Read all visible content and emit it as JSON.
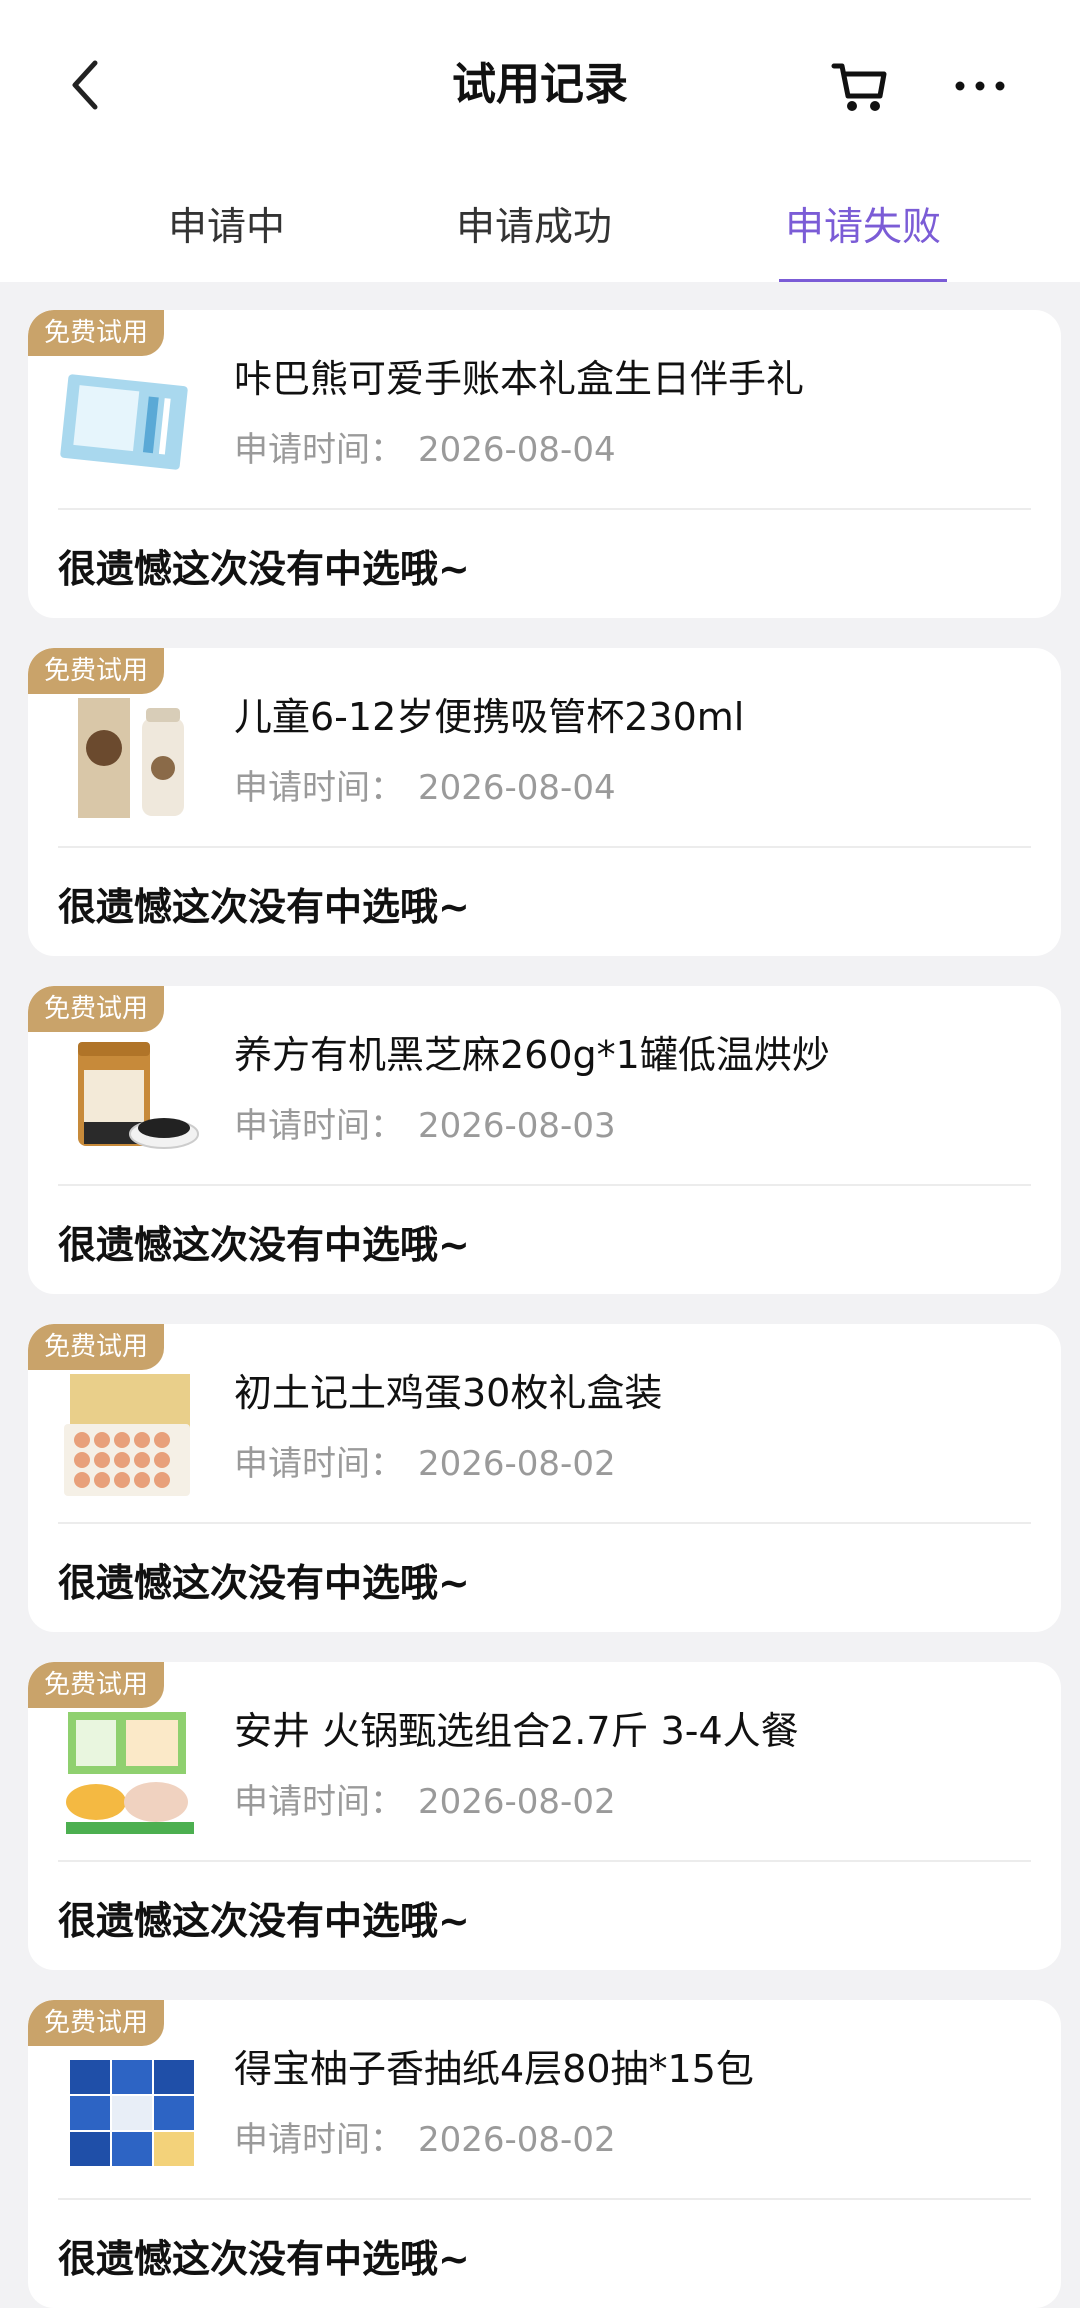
{
  "header": {
    "title": "试用记录",
    "back_icon": "chevron-left-icon",
    "cart_icon": "cart-icon",
    "more_icon": "more-dots-icon"
  },
  "tabs": [
    {
      "label": "申请中",
      "active": false
    },
    {
      "label": "申请成功",
      "active": false
    },
    {
      "label": "申请失败",
      "active": true
    }
  ],
  "colors": {
    "accent": "#7b5cd6",
    "badge": "#c9a36a",
    "background": "#f2f2f4"
  },
  "records": [
    {
      "badge": "免费试用",
      "title": "咔巴熊可爱手账本礼盒生日伴手礼",
      "apply_label": "申请时间：",
      "date": "2026-08-04",
      "result": "很遗憾这次没有中选哦~"
    },
    {
      "badge": "免费试用",
      "title": "儿童6-12岁便携吸管杯230ml",
      "apply_label": "申请时间：",
      "date": "2026-08-04",
      "result": "很遗憾这次没有中选哦~"
    },
    {
      "badge": "免费试用",
      "title": "养方有机黑芝麻260g*1罐低温烘炒",
      "apply_label": "申请时间：",
      "date": "2026-08-03",
      "result": "很遗憾这次没有中选哦~"
    },
    {
      "badge": "免费试用",
      "title": "初土记土鸡蛋30枚礼盒装",
      "apply_label": "申请时间：",
      "date": "2026-08-02",
      "result": "很遗憾这次没有中选哦~"
    },
    {
      "badge": "免费试用",
      "title": "安井 火锅甄选组合2.7斤 3-4人餐",
      "apply_label": "申请时间：",
      "date": "2026-08-02",
      "result": "很遗憾这次没有中选哦~"
    },
    {
      "badge": "免费试用",
      "title": "得宝柚子香抽纸4层80抽*15包",
      "apply_label": "申请时间：",
      "date": "2026-08-02",
      "result": "很遗憾这次没有中选哦~"
    }
  ]
}
